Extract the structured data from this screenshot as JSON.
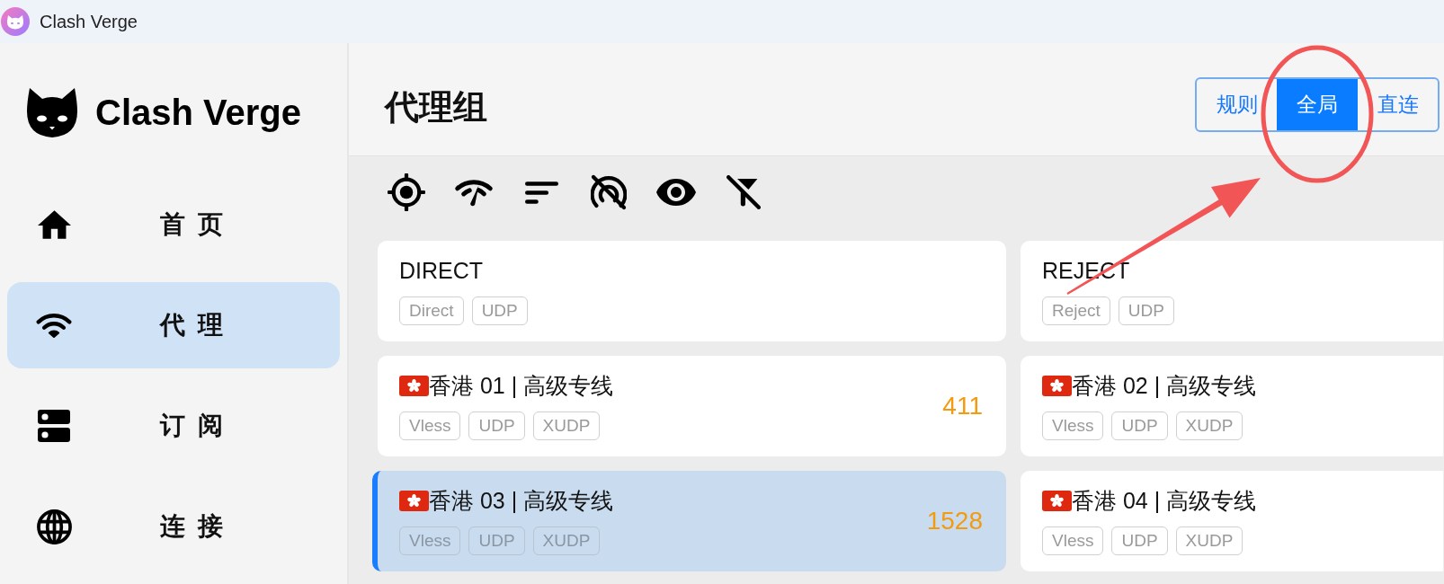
{
  "window": {
    "title": "Clash Verge"
  },
  "sidebar": {
    "logo_text": "Clash Verge",
    "items": [
      {
        "label": "首页",
        "selected": false
      },
      {
        "label": "代理",
        "selected": true
      },
      {
        "label": "订阅",
        "selected": false
      },
      {
        "label": "连接",
        "selected": false
      }
    ]
  },
  "header": {
    "title": "代理组",
    "mode_tabs": [
      {
        "label": "规则",
        "selected": false
      },
      {
        "label": "全局",
        "selected": true
      },
      {
        "label": "直连",
        "selected": false
      }
    ]
  },
  "proxies": [
    {
      "name": "DIRECT",
      "flag": false,
      "tags": [
        "Direct",
        "UDP"
      ],
      "selected": false
    },
    {
      "name": "REJECT",
      "flag": false,
      "tags": [
        "Reject",
        "UDP"
      ],
      "selected": false
    },
    {
      "name": "香港 01 | 高级专线",
      "flag": true,
      "tags": [
        "Vless",
        "UDP",
        "XUDP"
      ],
      "delay": "411",
      "selected": false
    },
    {
      "name": "香港 02 | 高级专线",
      "flag": true,
      "tags": [
        "Vless",
        "UDP",
        "XUDP"
      ],
      "selected": false
    },
    {
      "name": "香港 03 | 高级专线",
      "flag": true,
      "tags": [
        "Vless",
        "UDP",
        "XUDP"
      ],
      "delay": "1528",
      "selected": true
    },
    {
      "name": "香港 04 | 高级专线",
      "flag": true,
      "tags": [
        "Vless",
        "UDP",
        "XUDP"
      ],
      "selected": false
    }
  ]
}
